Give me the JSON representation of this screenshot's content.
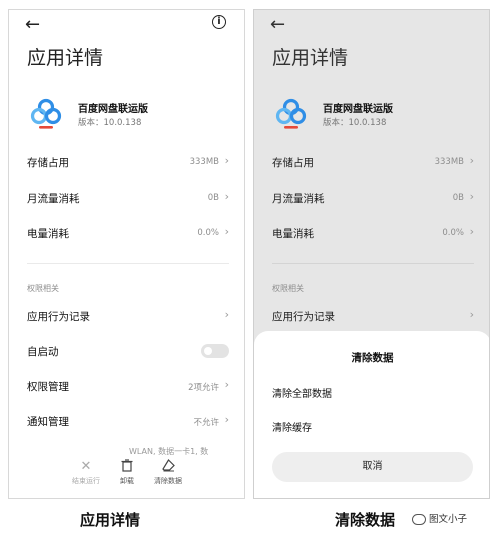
{
  "colors": {
    "accent": "#2f8ee6",
    "logo_red": "#e5493a",
    "sheet_bg": "#ffffff",
    "dim_bg": "#e6e6e6"
  },
  "left": {
    "back_icon": "arrow-left-icon",
    "info_icon": "info-icon",
    "info_glyph": "i",
    "title": "应用详情",
    "app": {
      "name": "百度网盘联运版",
      "version": "版本：10.0.138",
      "logo_icon": "baidu-netdisk-logo-icon"
    },
    "rows": [
      {
        "label": "存储占用",
        "value": "333MB"
      },
      {
        "label": "月流量消耗",
        "value": "0B"
      },
      {
        "label": "电量消耗",
        "value": "0.0%"
      }
    ],
    "section_label": "权限相关",
    "perm_rows": [
      {
        "label": "应用行为记录",
        "value": ""
      },
      {
        "label": "自启动",
        "value": ""
      },
      {
        "label": "权限管理",
        "value": "2项允许"
      },
      {
        "label": "通知管理",
        "value": "不允许"
      }
    ],
    "autostart_on": false,
    "partial_text": "WLAN, 数据一卡1, 数",
    "toolbar": [
      {
        "label": "结束运行",
        "icon": "close-icon",
        "disabled": true
      },
      {
        "label": "卸载",
        "icon": "trash-icon",
        "disabled": false
      },
      {
        "label": "清除数据",
        "icon": "eraser-icon",
        "disabled": false
      }
    ],
    "caption": "应用详情"
  },
  "right": {
    "title": "应用详情",
    "app": {
      "name": "百度网盘联运版",
      "version": "版本：10.0.138"
    },
    "rows": [
      {
        "label": "存储占用",
        "value": "333MB"
      },
      {
        "label": "月流量消耗",
        "value": "0B"
      },
      {
        "label": "电量消耗",
        "value": "0.0%"
      }
    ],
    "section_label": "权限相关",
    "perm_row": {
      "label": "应用行为记录"
    },
    "sheet": {
      "title": "清除数据",
      "options": [
        "清除全部数据",
        "清除缓存"
      ],
      "cancel": "取消"
    },
    "caption": "清除数据"
  },
  "watermark": "图文小子"
}
